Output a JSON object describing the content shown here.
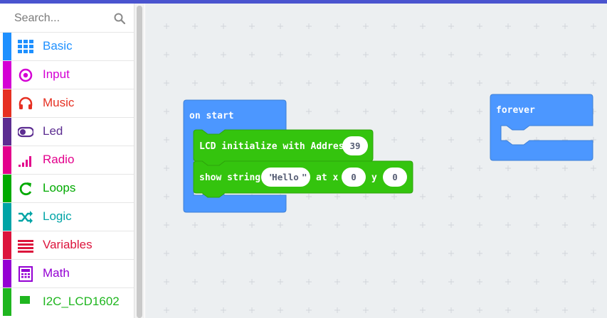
{
  "search": {
    "placeholder": "Search..."
  },
  "categories": [
    {
      "label": "Basic",
      "color": "#1e90ff",
      "icon": "grid-icon"
    },
    {
      "label": "Input",
      "color": "#d400d4",
      "icon": "target-icon"
    },
    {
      "label": "Music",
      "color": "#e63022",
      "icon": "headphones-icon"
    },
    {
      "label": "Led",
      "color": "#5c2d91",
      "icon": "toggle-icon"
    },
    {
      "label": "Radio",
      "color": "#e3008c",
      "icon": "signal-bars-icon"
    },
    {
      "label": "Loops",
      "color": "#00aa00",
      "icon": "loop-arrow-icon"
    },
    {
      "label": "Logic",
      "color": "#00a4a6",
      "icon": "shuffle-icon"
    },
    {
      "label": "Variables",
      "color": "#dc143c",
      "icon": "lines-icon"
    },
    {
      "label": "Math",
      "color": "#9400d3",
      "icon": "calculator-icon"
    },
    {
      "label": "I2C_LCD1602",
      "color": "#1fb61f",
      "icon": "square-icon"
    }
  ],
  "blocks": {
    "on_start": {
      "title": "on start",
      "lcd_init": {
        "text": "LCD initialize with Address",
        "address": "39"
      },
      "show_string": {
        "text": "show string",
        "value": "Hello",
        "at_x": "at x",
        "x": "0",
        "y_label": "y",
        "y": "0"
      }
    },
    "forever": {
      "title": "forever"
    }
  },
  "colors": {
    "basic_block": "#4c97ff",
    "lcd_block": "#34c40e",
    "topbar": "#4a54cf",
    "workspace": "#eceff1"
  }
}
